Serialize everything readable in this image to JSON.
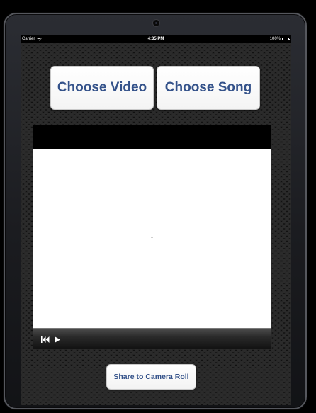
{
  "status_bar": {
    "carrier": "Carrier",
    "time": "4:35 PM",
    "battery": "100%",
    "wifi_icon": "wifi-icon",
    "battery_icon": "battery-icon"
  },
  "buttons": {
    "choose_video": "Choose Video",
    "choose_song": "Choose Song",
    "share": "Share to Camera Roll"
  },
  "player": {
    "rewind_icon": "rewind-icon",
    "play_icon": "play-icon"
  },
  "colors": {
    "button_text": "#34528a",
    "button_bg": "#ffffff",
    "screen_bg": "#111111",
    "player_bg": "#000000",
    "video_area": "#ffffff"
  }
}
